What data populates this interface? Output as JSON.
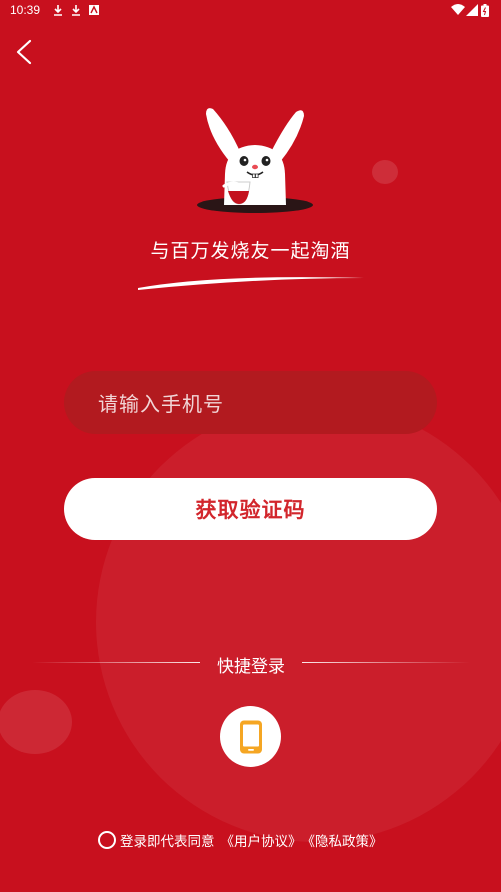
{
  "status_bar": {
    "time": "10:39",
    "icons": [
      "download-icon",
      "download-icon",
      "screenshot-icon",
      "wifi-icon",
      "signal-icon",
      "battery-icon"
    ]
  },
  "colors": {
    "background": "#C8101E",
    "input_background": "#B21A1F",
    "button_text": "#D2262C",
    "phone_icon": "#F5A623"
  },
  "header": {
    "back_icon": "chevron-left-icon"
  },
  "hero": {
    "mascot": "rabbit-wine-mascot",
    "slogan": "与百万发烧友一起淘酒"
  },
  "form": {
    "phone_placeholder": "请输入手机号",
    "phone_value": "",
    "get_code_label": "获取验证码"
  },
  "quick_login": {
    "title": "快捷登录",
    "phone_icon": "mobile-phone-icon"
  },
  "agreement": {
    "checked": false,
    "prefix": "登录即代表同意",
    "user_agreement": "《用户协议》",
    "privacy_policy": "《隐私政策》"
  }
}
